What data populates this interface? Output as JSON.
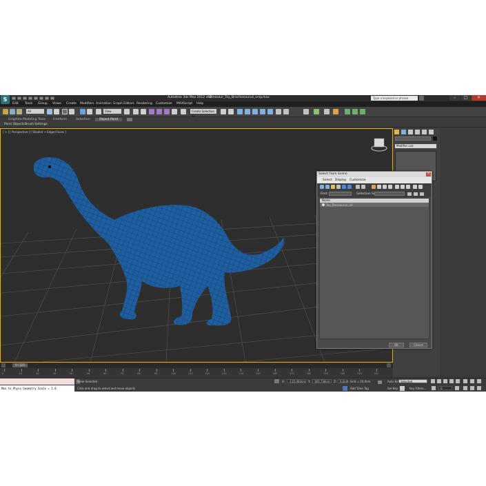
{
  "window": {
    "title": "Autodesk 3ds Max  2012 x64",
    "filename": "Dinosaur_Toy_Brachiosaurus_vray.max",
    "search_placeholder": "Type a keyword or phrase",
    "controls": [
      "–",
      "□",
      "✕"
    ]
  },
  "menubar": [
    "Edit",
    "Tools",
    "Group",
    "Views",
    "Create",
    "Modifiers",
    "Animation",
    "Graph Editors",
    "Rendering",
    "Customize",
    "MAXScript",
    "Help"
  ],
  "toolbar": {
    "filter_value": "All",
    "ref_coord_value": "View",
    "named_selection_placeholder": "Create Selection Se"
  },
  "ribbon": {
    "row1_tabs": [
      "Graphite Modeling Tools",
      "Freeform",
      "Selection",
      "Object Paint"
    ],
    "active_tab": "Object Paint",
    "row2_items": [
      "Paint Objects",
      "Brush Settings"
    ]
  },
  "viewport": {
    "label": "[ + ] [ Perspective ] [ Shaded + Edged Faces ]"
  },
  "command_panel": {
    "modifier_list_label": "Modifier List"
  },
  "dialog": {
    "title": "Select From Scene",
    "close": "✕",
    "menu": [
      "Select",
      "Display",
      "Customize"
    ],
    "find_label": "Find:",
    "selection_set_label": "Selection Set:",
    "column_header": "Name",
    "rows": [
      "Toy_Dinosaurus_vH"
    ],
    "ok_label": "OK",
    "cancel_label": "Cancel"
  },
  "timeline": {
    "frame_label": "0 / 225",
    "ticks": [
      "0",
      "10",
      "20",
      "30",
      "40",
      "50",
      "60",
      "70",
      "80",
      "90",
      "100",
      "110",
      "120",
      "130",
      "140",
      "150",
      "160",
      "170",
      "180",
      "190",
      "200",
      "210",
      "220"
    ]
  },
  "status": {
    "maxscript_output": "Max to Physx Geometry Scale = 1.0",
    "selection_status": "None Selected",
    "prompt": "Click and drag to select and move objects",
    "x_label": "X:",
    "x_value": "-115,064cm",
    "y_label": "Y:",
    "y_value": "165,734cm",
    "z_label": "Z:",
    "z_value": "0,0cm",
    "grid_label": "Grid = 10,0cm",
    "add_time_tag": "Add Time Tag",
    "auto_key_label": "Auto Key",
    "auto_key_value": "Selected",
    "set_key_label": "Set Key",
    "key_filters_label": "Key Filters...",
    "frame_value": "0"
  },
  "colors": {
    "viewport_border": "#f0b400",
    "dino_body": "#1f5fa0",
    "dialog_close": "#c84b3f"
  },
  "icons": [
    "app-logo-icon",
    "undo-icon",
    "redo-icon",
    "select-icon",
    "move-icon",
    "rotate-icon",
    "scale-icon",
    "render-icon",
    "viewcube-icon",
    "create-tab-icon",
    "modify-tab-icon"
  ]
}
